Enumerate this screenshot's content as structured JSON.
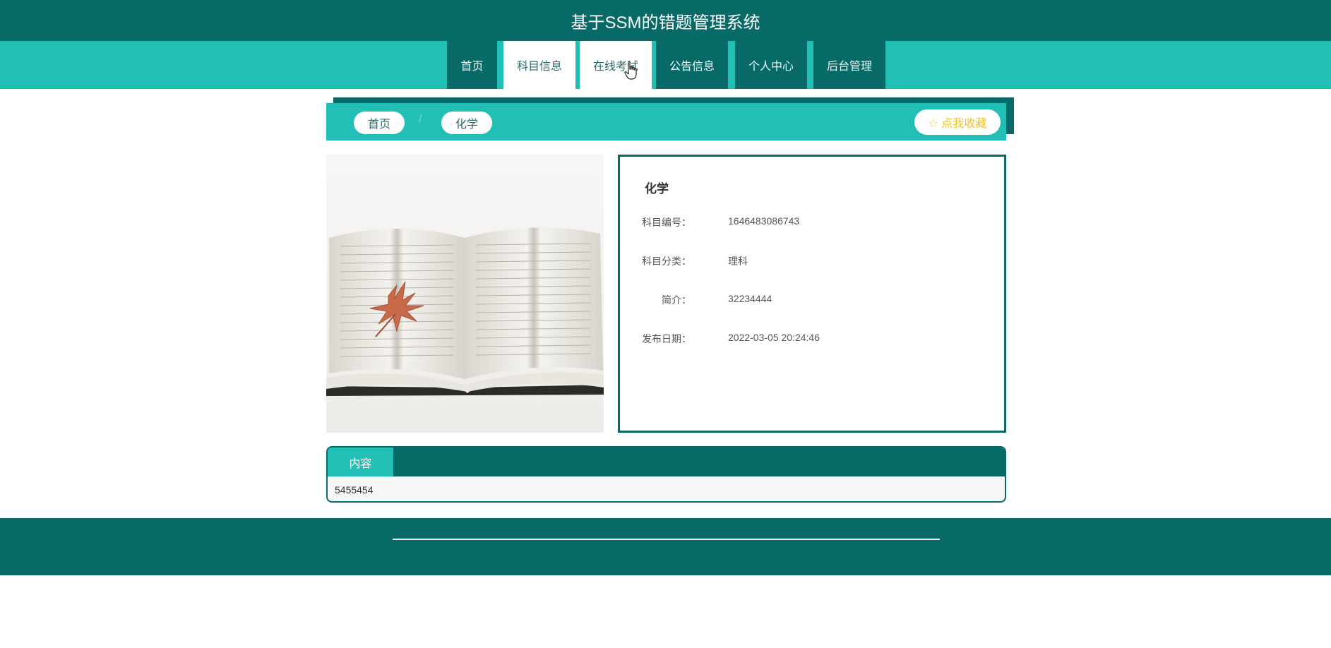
{
  "header": {
    "title": "基于SSM的错题管理系统"
  },
  "nav": {
    "items": [
      {
        "label": "首页"
      },
      {
        "label": "科目信息"
      },
      {
        "label": "在线考试"
      },
      {
        "label": "公告信息"
      },
      {
        "label": "个人中心"
      },
      {
        "label": "后台管理"
      }
    ],
    "active": "科目信息",
    "hovered": "在线考试"
  },
  "breadcrumb": {
    "home": "首页",
    "separator": "/",
    "current": "化学",
    "favorite_label": "☆ 点我收藏"
  },
  "subject": {
    "name": "化学",
    "fields": [
      {
        "label": "科目编号：",
        "value": "1646483086743"
      },
      {
        "label": "科目分类：",
        "value": "理科"
      },
      {
        "label": "简介：",
        "value": "32234444"
      },
      {
        "label": "发布日期：",
        "value": "2022-03-05 20:24:46"
      }
    ]
  },
  "content": {
    "tab_label": "内容",
    "body": "5455454"
  },
  "colors": {
    "dark_teal": "#076a67",
    "teal": "#22bfb6",
    "favorite_text": "#f3c320"
  }
}
